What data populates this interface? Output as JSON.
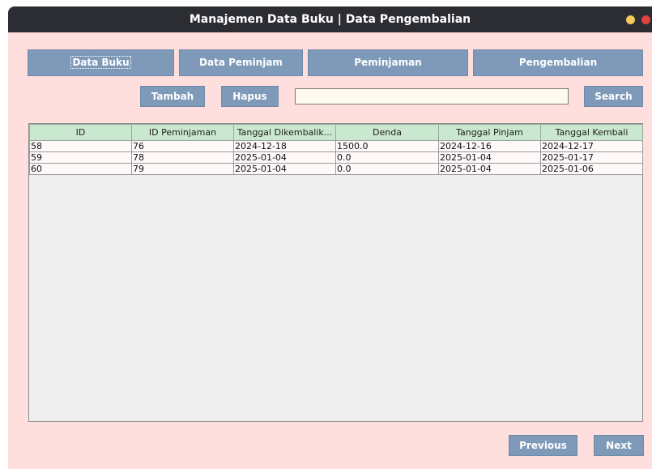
{
  "window": {
    "title": "Manajemen Data Buku | Data Pengembalian"
  },
  "nav": {
    "data_buku": "Data Buku",
    "data_peminjam": "Data Peminjam",
    "peminjaman": "Peminjaman",
    "pengembalian": "Pengembalian"
  },
  "toolbar": {
    "tambah": "Tambah",
    "hapus": "Hapus",
    "search_value": "",
    "search": "Search"
  },
  "table": {
    "columns": [
      "ID",
      "ID Peminjaman",
      "Tanggal Dikembalik...",
      "Denda",
      "Tanggal Pinjam",
      "Tanggal Kembali"
    ],
    "rows": [
      [
        "58",
        "76",
        "2024-12-18",
        "1500.0",
        "2024-12-16",
        "2024-12-17"
      ],
      [
        "59",
        "78",
        "2025-01-04",
        "0.0",
        "2025-01-04",
        "2025-01-17"
      ],
      [
        "60",
        "79",
        "2025-01-04",
        "0.0",
        "2025-01-04",
        "2025-01-06"
      ]
    ]
  },
  "pagination": {
    "previous": "Previous",
    "next": "Next"
  },
  "colors": {
    "background": "#ffdede",
    "button": "#7e9ab8",
    "header": "#c9e8cf",
    "titlebar": "#2b2d33"
  }
}
